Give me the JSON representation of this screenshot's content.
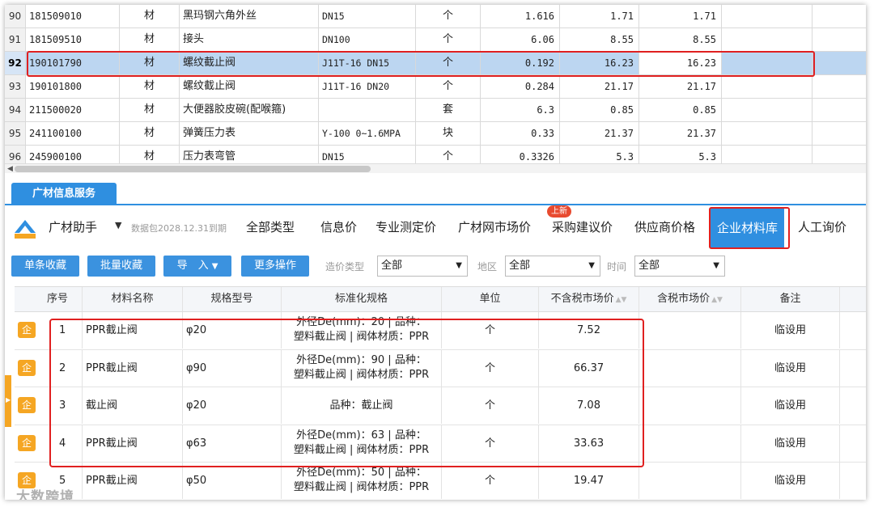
{
  "sheet": {
    "rows": [
      {
        "num": "90",
        "code": "181509010",
        "type": "材",
        "name": "黑玛钢六角外丝",
        "spec": "DN15",
        "unit": "个",
        "qty": "1.616",
        "p1": "1.71",
        "p2": "1.71"
      },
      {
        "num": "91",
        "code": "181509510",
        "type": "材",
        "name": "接头",
        "spec": "DN100",
        "unit": "个",
        "qty": "6.06",
        "p1": "8.55",
        "p2": "8.55"
      },
      {
        "num": "92",
        "code": "190101790",
        "type": "材",
        "name": "螺纹截止阀",
        "spec": "J11T-16 DN15",
        "unit": "个",
        "qty": "0.192",
        "p1": "16.23",
        "p2": "16.23"
      },
      {
        "num": "93",
        "code": "190101800",
        "type": "材",
        "name": "螺纹截止阀",
        "spec": "J11T-16 DN20",
        "unit": "个",
        "qty": "0.284",
        "p1": "21.17",
        "p2": "21.17"
      },
      {
        "num": "94",
        "code": "211500020",
        "type": "材",
        "name": "大便器胶皮碗(配喉箍)",
        "spec": "",
        "unit": "套",
        "qty": "6.3",
        "p1": "0.85",
        "p2": "0.85"
      },
      {
        "num": "95",
        "code": "241100100",
        "type": "材",
        "name": "弹簧压力表",
        "spec": "Y-100 0~1.6MPA",
        "unit": "块",
        "qty": "0.33",
        "p1": "21.37",
        "p2": "21.37"
      },
      {
        "num": "96",
        "code": "245900100",
        "type": "材",
        "name": "压力表弯管",
        "spec": "DN15",
        "unit": "个",
        "qty": "0.3326",
        "p1": "5.3",
        "p2": "5.3"
      }
    ]
  },
  "panel": {
    "tab_label": "广材信息服务",
    "assistant_label": "广材助手",
    "expiry": "数据包2028.12.31到期",
    "nav": [
      "全部类型",
      "信息价",
      "专业测定价",
      "广材网市场价",
      "采购建议价",
      "供应商价格",
      "企业材料库",
      "人工询价"
    ],
    "new_badge": "上新"
  },
  "actions": {
    "fav_single": "单条收藏",
    "fav_batch": "批量收藏",
    "import": "导　入",
    "more": "更多操作",
    "price_type_label": "造价类型",
    "price_type_value": "全部",
    "region_label": "地区",
    "region_value": "全部",
    "time_label": "时间",
    "time_value": "全部"
  },
  "table": {
    "headers": {
      "seq": "序号",
      "name": "材料名称",
      "spec": "规格型号",
      "std": "标准化规格",
      "unit": "单位",
      "p1": "不含税市场价",
      "p2": "含税市场价",
      "note": "备注"
    },
    "icon_text": "企",
    "rows": [
      {
        "seq": "1",
        "name": "PPR截止阀",
        "spec": "φ20",
        "std_a": "外径De(mm)：20 | 品种：",
        "std_b": "塑料截止阀 | 阀体材质：PPR",
        "unit": "个",
        "p1": "7.52",
        "note": "临设用"
      },
      {
        "seq": "2",
        "name": "PPR截止阀",
        "spec": "φ90",
        "std_a": "外径De(mm)：90 | 品种：",
        "std_b": "塑料截止阀 | 阀体材质：PPR",
        "unit": "个",
        "p1": "66.37",
        "note": "临设用"
      },
      {
        "seq": "3",
        "name": "截止阀",
        "spec": "φ20",
        "std_a": "品种：截止阀",
        "std_b": "",
        "unit": "个",
        "p1": "7.08",
        "note": "临设用"
      },
      {
        "seq": "4",
        "name": "PPR截止阀",
        "spec": "φ63",
        "std_a": "外径De(mm)：63 | 品种：",
        "std_b": "塑料截止阀 | 阀体材质：PPR",
        "unit": "个",
        "p1": "33.63",
        "note": "临设用"
      },
      {
        "seq": "5",
        "name": "PPR截止阀",
        "spec": "φ50",
        "std_a": "外径De(mm)：50 | 品种：",
        "std_b": "塑料截止阀 | 阀体材质：PPR",
        "unit": "个",
        "p1": "19.47",
        "note": "临设用"
      }
    ]
  },
  "watermark": "大数跨境",
  "colors": {
    "accent": "#2f8fe0",
    "highlight": "#e02020",
    "icon": "#f5a623",
    "selected_row": "#bcd6f1"
  }
}
